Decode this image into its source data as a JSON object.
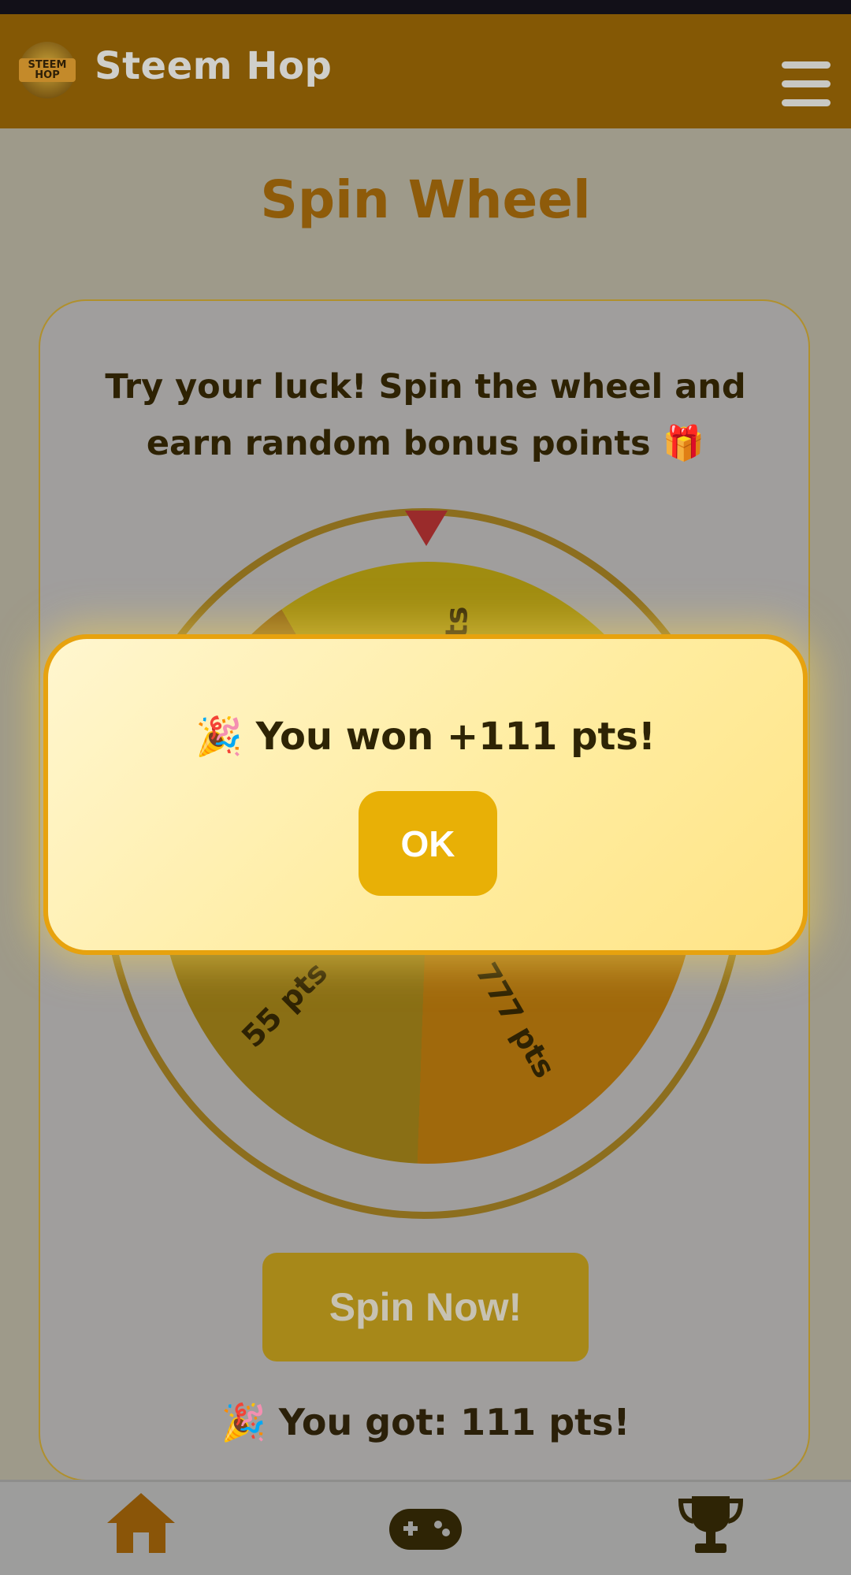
{
  "header": {
    "logo_text": "STEEM HOP",
    "app_title": "Steem Hop",
    "menu_icon": "hamburger-menu-icon"
  },
  "page": {
    "title": "Spin Wheel",
    "intro_line1": "Try your luck! Spin the wheel and",
    "intro_line2": "earn random bonus points 🎁"
  },
  "wheel": {
    "labels": {
      "top": "ts",
      "bottom_left": "55 pts",
      "bottom_right": "777 pts"
    },
    "colors": {
      "pointer": "#d33a3a",
      "ring": "#c6a019"
    }
  },
  "spin_button": {
    "label": "Spin Now!"
  },
  "result": {
    "text": "🎉 You got: 111 pts!"
  },
  "modal": {
    "message": "🎉 You won +111 pts!",
    "ok_label": "OK"
  },
  "bottom_nav": {
    "items": [
      {
        "name": "home",
        "icon": "home-icon"
      },
      {
        "name": "games",
        "icon": "gamepad-icon"
      },
      {
        "name": "leaderboard",
        "icon": "trophy-icon"
      }
    ]
  },
  "colors": {
    "header_bg": "#845805",
    "accent": "#e8b006",
    "modal_border": "#e7a20e"
  }
}
